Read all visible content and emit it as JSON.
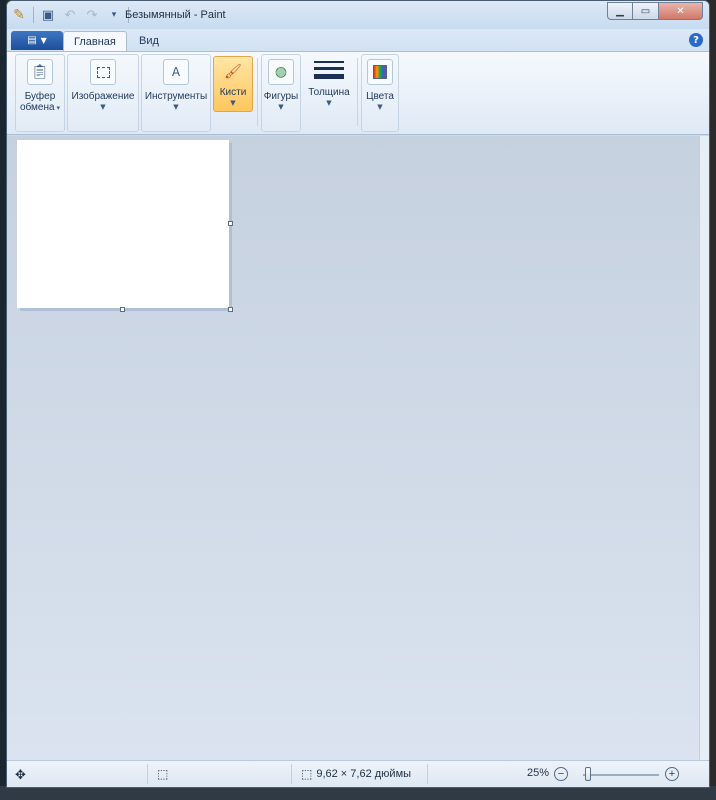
{
  "window": {
    "title": "Безымянный - Paint"
  },
  "tabs": [
    {
      "label": "Главная",
      "active": true
    },
    {
      "label": "Вид",
      "active": false
    }
  ],
  "ribbon": {
    "clipboard": {
      "label_line1": "Буфер",
      "label_line2": "обмена",
      "icon": "clipboard-icon"
    },
    "image": {
      "label": "Изображение",
      "icon": "select-icon"
    },
    "tools": {
      "label": "Инструменты",
      "icon": "tools-icon"
    },
    "brushes": {
      "label": "Кисти",
      "icon": "brush-icon",
      "selected": true
    },
    "shapes": {
      "label": "Фигуры",
      "icon": "shapes-icon"
    },
    "size": {
      "label": "Толщина",
      "icon": "line-size-icon"
    },
    "colors": {
      "label": "Цвета",
      "icon": "palette-icon"
    }
  },
  "status": {
    "image_size": "9,62 × 7,62 дюймы",
    "zoom": "25%"
  },
  "colors": {
    "accent": "#2a5ba8",
    "brush_selected": "#ffc65c"
  }
}
